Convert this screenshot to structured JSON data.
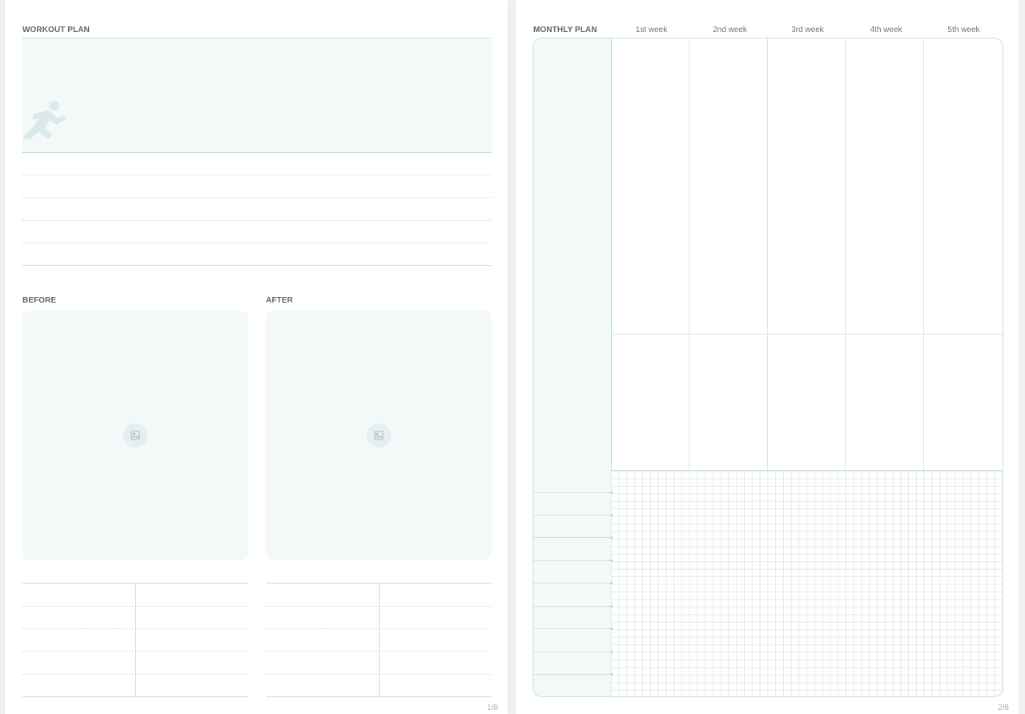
{
  "left_page": {
    "workout_plan_title": "WORKOUT PLAN",
    "before_title": "BEFORE",
    "after_title": "AFTER",
    "page_number": "1/8",
    "hero_icon": "runner-icon",
    "photo_icon": "image-placeholder-icon"
  },
  "right_page": {
    "monthly_plan_title": "MONTHLY PLAN",
    "weeks": [
      "1st week",
      "2nd week",
      "3rd week",
      "4th week",
      "5th week"
    ],
    "page_number": "2/8"
  },
  "colors": {
    "accent_line": "#c5dfe4",
    "panel_fill": "#f3f8f9",
    "label_text": "#5b6770"
  }
}
